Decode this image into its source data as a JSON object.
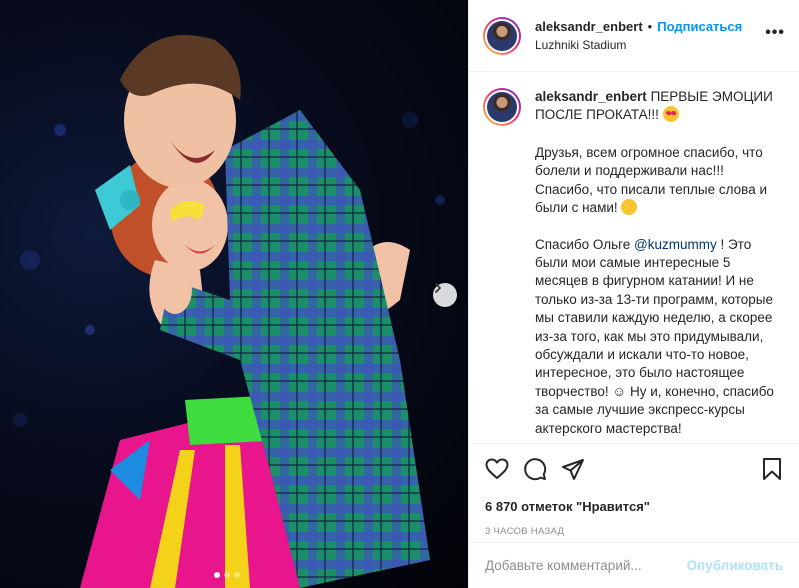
{
  "header": {
    "username": "aleksandr_enbert",
    "separator": "•",
    "follow_label": "Подписаться",
    "location": "Luzhniki Stadium",
    "more_label": "•••"
  },
  "caption": {
    "username": "aleksandr_enbert",
    "title": "ПЕРВЫЕ ЭМОЦИИ ПОСЛЕ ПРОКАТА!!!",
    "para1": "Друзья, всем огромное спасибо, что болели и поддерживали нас!!! Спасибо, что писали теплые слова и были с нами!",
    "para2_before": "Спасибо Ольге ",
    "mention": "@kuzmummy",
    "para2_after": " ! Это были мои самые интересные 5 месяцев в фигурном катании! И не только из-за 13-ти программ, которые мы ставили каждую неделю, а скорее из-за того, как мы это придумывали, обсуждали и искали что-то новое, интересное, это было настоящее творчество! ☺ Ну и, конечно, спасибо за самые лучшие экспресс-курсы актерского мастерства!"
  },
  "post": {
    "likes": "6 870 отметок \"Нравится\"",
    "time": "3 часов назад"
  },
  "comment": {
    "placeholder": "Добавьте комментарий...",
    "publish_label": "Опубликовать"
  },
  "carousel": {
    "total": 3,
    "active": 1
  },
  "icons": [
    "heart-icon",
    "comment-icon",
    "share-icon",
    "bookmark-icon",
    "chevron-right-icon"
  ],
  "colors": {
    "accent": "#0095f6",
    "publish_disabled": "#b2dffc",
    "muted": "#8e8e8e"
  }
}
